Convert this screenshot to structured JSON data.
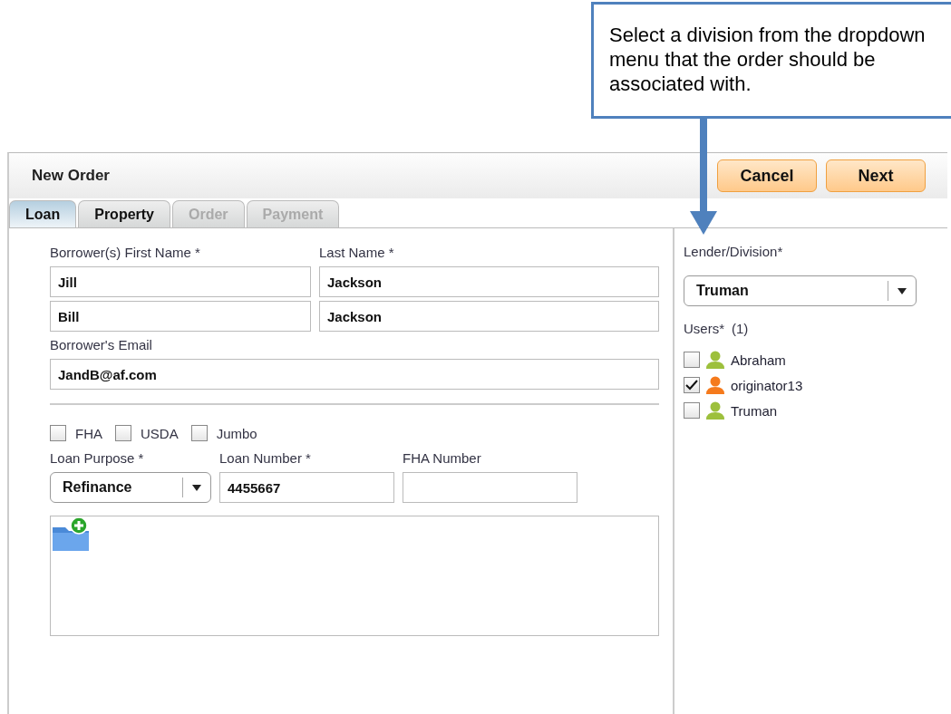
{
  "callout": {
    "text": "Select a division from the dropdown menu that the order should be associated with."
  },
  "window": {
    "title": "New Order"
  },
  "buttons": [
    {
      "label": "Cancel"
    },
    {
      "label": "Next"
    }
  ],
  "tabs": [
    {
      "label": "Loan",
      "selected": true,
      "disabled": false
    },
    {
      "label": "Property",
      "selected": false,
      "disabled": false
    },
    {
      "label": "Order",
      "selected": false,
      "disabled": true
    },
    {
      "label": "Payment",
      "selected": false,
      "disabled": true
    }
  ],
  "borrowers": {
    "first_name_label": "Borrower(s) First Name *",
    "last_name_label": "Last Name *",
    "rows": [
      {
        "first": "Jill",
        "last": "Jackson"
      },
      {
        "first": "Bill",
        "last": "Jackson"
      }
    ]
  },
  "email": {
    "label": "Borrower's Email",
    "value": "JandB@af.com"
  },
  "loan_types": [
    {
      "label": "FHA",
      "checked": false
    },
    {
      "label": "USDA",
      "checked": false
    },
    {
      "label": "Jumbo",
      "checked": false
    }
  ],
  "loan_purpose": {
    "label": "Loan Purpose *",
    "value": "Refinance"
  },
  "loan_number": {
    "label": "Loan Number *",
    "value": "4455667"
  },
  "fha_number": {
    "label": "FHA Number"
  },
  "lender": {
    "label": "Lender/Division*",
    "value": "Truman"
  },
  "users": {
    "label": "Users*",
    "count": "(1)",
    "items": [
      {
        "name": "Abraham",
        "checked": false,
        "color": "#9dc03c"
      },
      {
        "name": "originator13",
        "checked": true,
        "color": "#f57a1c"
      },
      {
        "name": "Truman",
        "checked": false,
        "color": "#9dc03c"
      }
    ]
  }
}
